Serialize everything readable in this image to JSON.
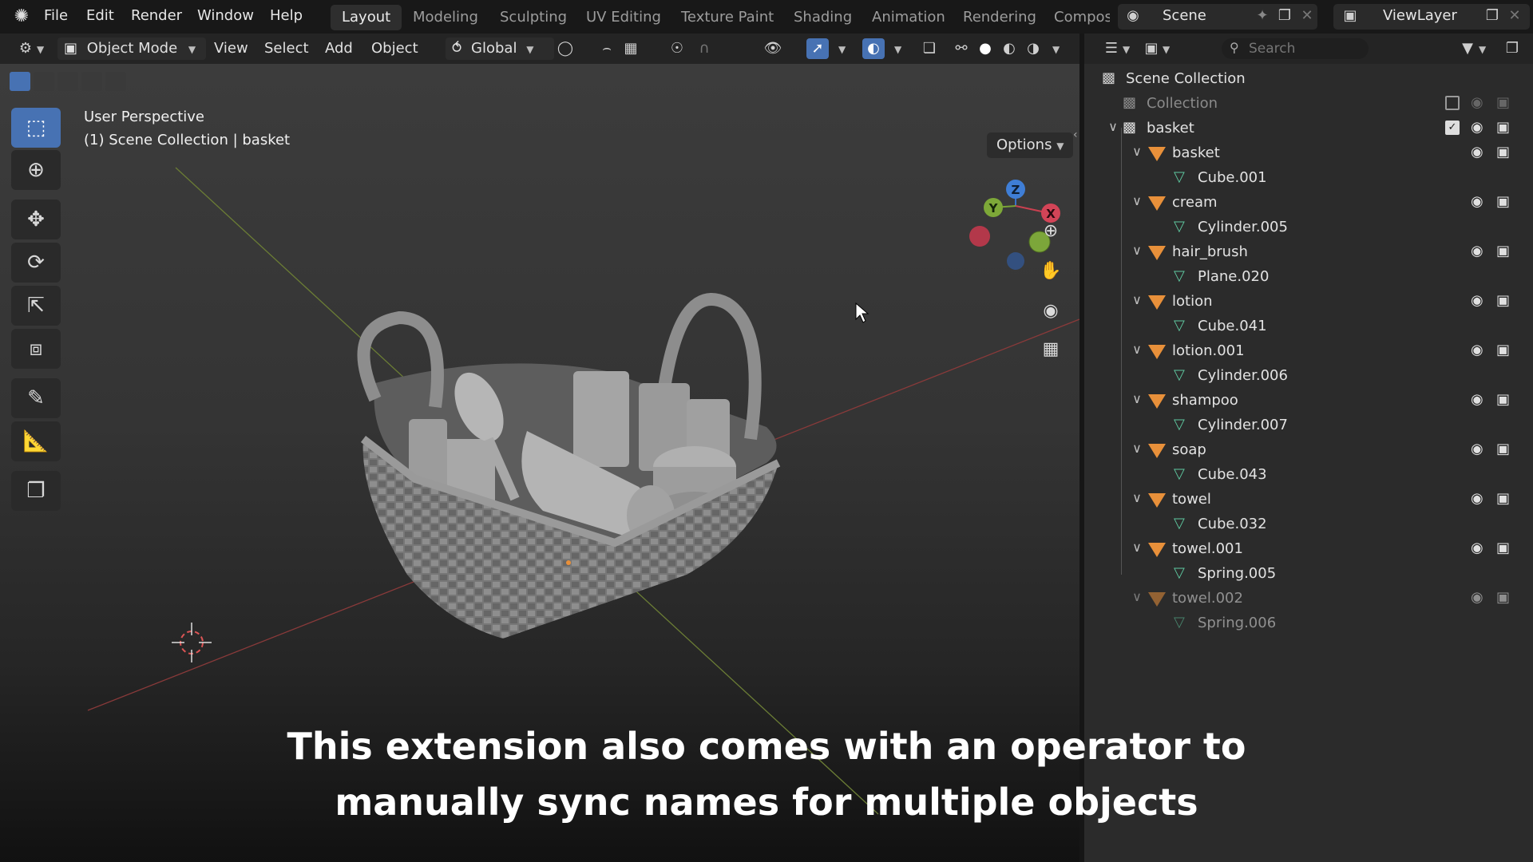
{
  "menu": {
    "items": [
      "File",
      "Edit",
      "Render",
      "Window",
      "Help"
    ]
  },
  "workspaces": {
    "tabs": [
      "Layout",
      "Modeling",
      "Sculpting",
      "UV Editing",
      "Texture Paint",
      "Shading",
      "Animation",
      "Rendering",
      "Compos"
    ]
  },
  "scene": {
    "name": "Scene"
  },
  "view_layer": {
    "name": "ViewLayer"
  },
  "viewport_header": {
    "mode": "Object Mode",
    "menus": [
      "View",
      "Select",
      "Add",
      "Object"
    ],
    "transform_orientation": "Global"
  },
  "viewport": {
    "info_line1": "User Perspective",
    "info_line2": "(1) Scene Collection | basket",
    "options_label": "Options",
    "gizmo_axes": {
      "z": "Z",
      "y": "Y",
      "x": "X"
    }
  },
  "outliner": {
    "search_placeholder": "Search",
    "root": "Scene Collection",
    "collection_label": "Collection",
    "basket_collection": "basket",
    "objects": [
      {
        "name": "basket",
        "mesh": "Cube.001"
      },
      {
        "name": "cream",
        "mesh": "Cylinder.005"
      },
      {
        "name": "hair_brush",
        "mesh": "Plane.020"
      },
      {
        "name": "lotion",
        "mesh": "Cube.041"
      },
      {
        "name": "lotion.001",
        "mesh": "Cylinder.006"
      },
      {
        "name": "shampoo",
        "mesh": "Cylinder.007"
      },
      {
        "name": "soap",
        "mesh": "Cube.043"
      },
      {
        "name": "towel",
        "mesh": "Cube.032"
      },
      {
        "name": "towel.001",
        "mesh": "Spring.005"
      },
      {
        "name": "towel.002",
        "mesh": "Spring.006"
      }
    ]
  },
  "subtitle": {
    "line1": "This extension also comes with an operator to",
    "line2": "manually sync names for multiple objects"
  },
  "colors": {
    "accent": "#4772b3",
    "object_icon": "#e8903a",
    "mesh_icon": "#5fc9a0"
  }
}
